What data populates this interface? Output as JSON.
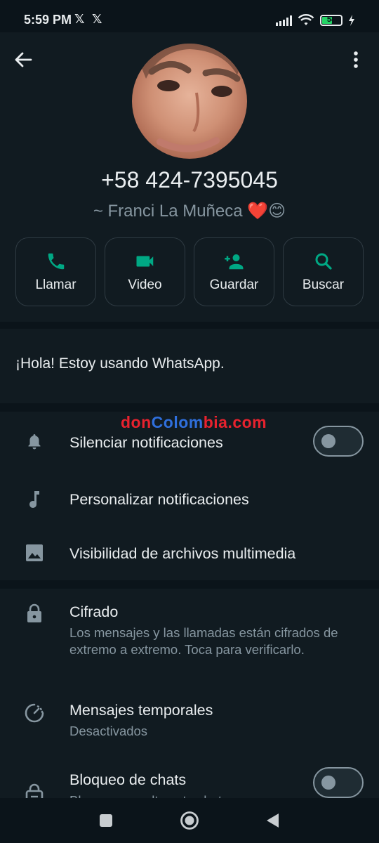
{
  "status_bar": {
    "time": "5:59 PM",
    "notif_icons": [
      "𝕏",
      "𝕏"
    ],
    "battery_level": "54"
  },
  "contact": {
    "phone": "+58 424-7395045",
    "name": "~ Franci La Muñeca ❤️😊"
  },
  "actions": [
    {
      "label": "Llamar",
      "icon": "phone-icon"
    },
    {
      "label": "Video",
      "icon": "video-camera-icon"
    },
    {
      "label": "Guardar",
      "icon": "add-person-icon"
    },
    {
      "label": "Buscar",
      "icon": "search-icon"
    }
  ],
  "about": {
    "text": "¡Hola! Estoy usando WhatsApp."
  },
  "watermark": {
    "parts": [
      "don",
      "Co",
      "lom",
      "bia",
      ".com"
    ],
    "colors": [
      "#e8222e",
      "#2f6fdc",
      "#2f6fdc",
      "#e8222e",
      "#e8222e"
    ]
  },
  "settings": {
    "mute": {
      "title": "Silenciar notificaciones",
      "enabled": false
    },
    "custom_notifications": {
      "title": "Personalizar notificaciones"
    },
    "media_visibility": {
      "title": "Visibilidad de archivos multimedia"
    },
    "encryption": {
      "title": "Cifrado",
      "subtitle": "Los mensajes y las llamadas están cifrados de extremo a extremo. Toca para verificarlo."
    },
    "disappearing": {
      "title": "Mensajes temporales",
      "subtitle": "Desactivados"
    },
    "chat_lock": {
      "title": "Bloqueo de chats",
      "subtitle": "Bloquea y oculta este chat",
      "enabled": false
    }
  },
  "colors": {
    "background": "#0b141a",
    "panel": "#111b21",
    "accent": "#00a884",
    "text": "#e9edef",
    "secondary": "#8696a0"
  }
}
